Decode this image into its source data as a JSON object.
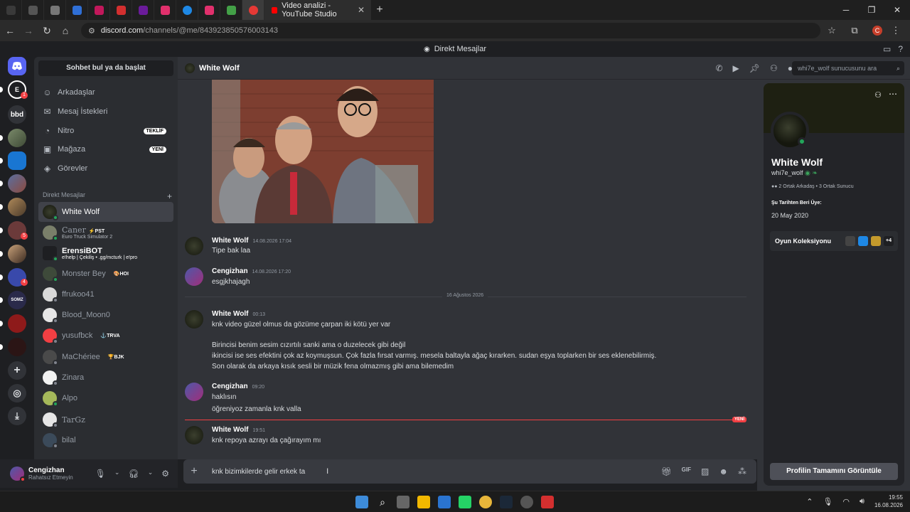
{
  "browser": {
    "active_tab_title": "Video analizi - YouTube Studio",
    "url_host": "discord.com",
    "url_path": "/channels/@me/843923850576003143",
    "profile_initial": "C"
  },
  "discord_title": "Direkt Mesajlar",
  "rail": {
    "server_labels": [
      "bbd"
    ],
    "badges": [
      "1",
      "5",
      "4"
    ]
  },
  "sidebar": {
    "search_label": "Sohbet bul ya da başlat",
    "nav": [
      {
        "label": "Arkadaşlar"
      },
      {
        "label": "Mesaj İstekleri"
      },
      {
        "label": "Nitro",
        "pill": "TEKLİF"
      },
      {
        "label": "Mağaza",
        "pill": "YENİ"
      },
      {
        "label": "Görevler"
      }
    ],
    "dm_header": "Direkt Mesajlar",
    "dms": [
      {
        "name": "White Wolf"
      },
      {
        "name": "Caner",
        "tag": "PST",
        "sub": "Euro Truck Simulator 2"
      },
      {
        "name": "ErensiBOT",
        "sub": "e!help | Çekiliş • .gg/mcturk | e!pro"
      },
      {
        "name": "Monster Bey",
        "tag": "HOI"
      },
      {
        "name": "ffrukoo41"
      },
      {
        "name": "Blood_Moon0"
      },
      {
        "name": "yusufbck",
        "tag": "TRVA"
      },
      {
        "name": "MaChériee",
        "tag": "BJK"
      },
      {
        "name": "Zinara"
      },
      {
        "name": "Alpo"
      },
      {
        "name": "TarGz"
      },
      {
        "name": "bilal"
      }
    ]
  },
  "user_panel": {
    "name": "Cengizhan",
    "status": "Rahatsız Etmeyin"
  },
  "chat_header": {
    "name": "White Wolf",
    "search_placeholder": "whi7e_wolf sunucusunu ara"
  },
  "messages": [
    {
      "author": "White Wolf",
      "ts": "14.08.2026 17:04",
      "lines": [
        "Tipe bak laa"
      ]
    },
    {
      "author": "Cengizhan",
      "ts": "14.08.2026 17:20",
      "lines": [
        "esgjkhajagh"
      ]
    },
    {
      "divider": "16 Ağustos 2026"
    },
    {
      "author": "White Wolf",
      "ts": "00:13",
      "lines": [
        "knk video güzel olmus da gözüme çarpan iki kötü yer var",
        "",
        "Birincisi benim sesim cızırtılı sanki ama o duzelecek gibi değil",
        "ikincisi ise ses efektini çok az koymuşsun. Çok fazla fırsat varmış. mesela baltayla ağaç kırarken. sudan eşya toplarken bir ses eklenebilirmiş.",
        "Son olarak da arkaya kısık sesli bir müzik fena olmazmış gibi ama bilemedim"
      ]
    },
    {
      "author": "Cengizhan",
      "ts": "09:20",
      "lines": [
        "haklısın",
        "öğreniyoz zamanla knk valla"
      ]
    },
    {
      "author": "White Wolf",
      "ts": "19:51",
      "lines": [
        "knk repoya azrayı da çağırayım mı"
      ]
    }
  ],
  "new_label": "YENİ",
  "composer_text": "knk bizimkilerde gelir erkek ta",
  "profile": {
    "display_name": "White Wolf",
    "username": "whi7e_wolf",
    "mutuals": "2 Ortak Arkadaş • 3 Ortak Sunucu",
    "member_since_label": "Şu Tarihten Beri Üye:",
    "member_since": "20 May 2020",
    "game_collection": "Oyun Koleksiyonu",
    "game_more": "+4",
    "full_profile_button": "Profilin Tamamını Görüntüle"
  },
  "taskbar": {
    "time": "19:55",
    "date": "16.08.2026"
  },
  "colors": {
    "accent_red": "#f23f43",
    "online": "#23a55a",
    "blurple": "#5865f2"
  }
}
